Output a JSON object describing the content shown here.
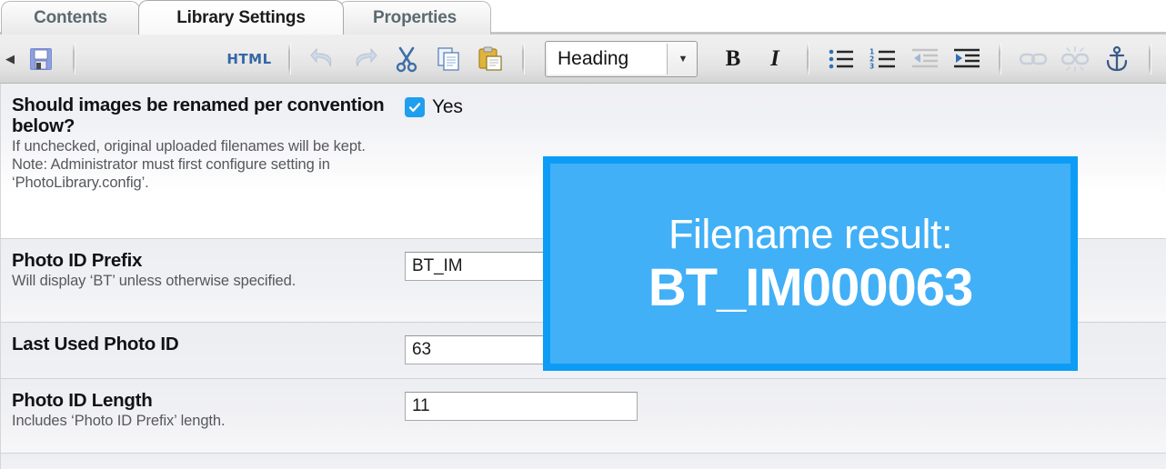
{
  "tabs": [
    {
      "label": "Contents",
      "active": false,
      "name": "tab-contents"
    },
    {
      "label": "Library Settings",
      "active": true,
      "name": "tab-library-settings"
    },
    {
      "label": "Properties",
      "active": false,
      "name": "tab-properties"
    }
  ],
  "toolbar": {
    "collapse_arrow": "◀",
    "save_icon": "save-icon",
    "html_label": "HTML",
    "undo_icon": "undo-icon",
    "redo_icon": "redo-icon",
    "cut_icon": "cut-scissors-icon",
    "copy_icon": "copy-icon",
    "paste_icon": "paste-icon",
    "style_select": {
      "value": "Heading",
      "arrow": "▼"
    },
    "bold_label": "B",
    "italic_label": "I",
    "bullet_list_icon": "bulleted-list-icon",
    "numbered_list_icon": "numbered-list-icon",
    "outdent_icon": "decrease-indent-icon",
    "indent_icon": "increase-indent-icon",
    "link_icon": "insert-link-icon",
    "unlink_icon": "remove-link-icon",
    "anchor_icon": "anchor-icon",
    "image_icon": "insert-image-icon"
  },
  "form": {
    "rows": [
      {
        "title": "Should images be renamed per convention below?",
        "desc": "If unchecked, original uploaded filenames will be kept. Note: Administrator must first configure setting in ‘PhotoLibrary.config’.",
        "control": "checkbox",
        "checked_label": "Yes"
      },
      {
        "title": "Photo ID Prefix",
        "desc": "Will display ‘BT’ unless otherwise specified.",
        "control": "text",
        "value": "BT_IM"
      },
      {
        "title": "Last Used Photo ID",
        "desc": "",
        "control": "text",
        "value": "63"
      },
      {
        "title": "Photo ID Length",
        "desc": "Includes ‘Photo ID Prefix’ length.",
        "control": "text",
        "value": "11"
      }
    ]
  },
  "callout": {
    "line1": "Filename result:",
    "line2": "BT_IM000063",
    "border_color": "#0c9cf5",
    "fill_color": "#41b0f7",
    "text_color": "#ffffff"
  },
  "colors": {
    "accent_blue": "#1f9fee",
    "toolbar_bg": "#e8e8e8",
    "row_bg": "#f1f1f4",
    "active_tab_text": "#1c1c1c",
    "inactive_tab_text": "#5b6a70"
  }
}
